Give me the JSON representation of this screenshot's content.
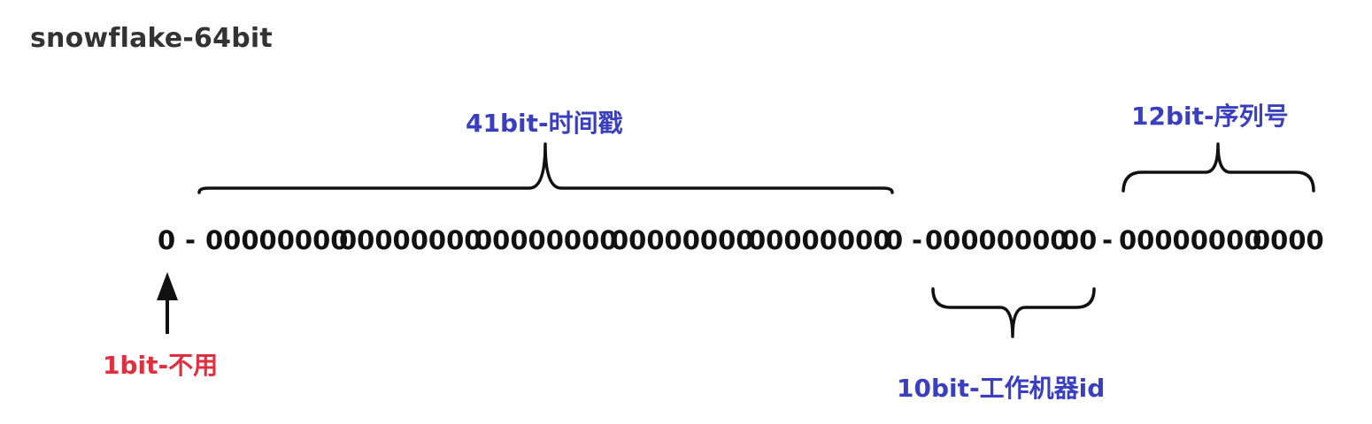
{
  "title": "snowflake-64bit",
  "labels": {
    "timestamp": "41bit-时间戳",
    "sequence": "12bit-序列号",
    "sign": "1bit-不用",
    "worker": "10bit-工作机器id"
  },
  "bits": {
    "sign": "0",
    "dash1": "-",
    "timestamp_groups": [
      "00000000",
      "00000000",
      "00000000",
      "00000000",
      "00000000",
      "0"
    ],
    "dash2": "-",
    "worker_groups": [
      "00000000",
      "00"
    ],
    "dash3": "-",
    "sequence_groups": [
      "00000000",
      "0000"
    ]
  },
  "colors": {
    "blue": "#3a3fc0",
    "red": "#e03040",
    "text": "#111111",
    "title": "#333333"
  },
  "icons": {
    "sign_arrow": "arrow-up-icon",
    "timestamp_brace": "brace-top-icon",
    "sequence_brace": "brace-top-icon",
    "worker_brace": "brace-bottom-icon"
  }
}
